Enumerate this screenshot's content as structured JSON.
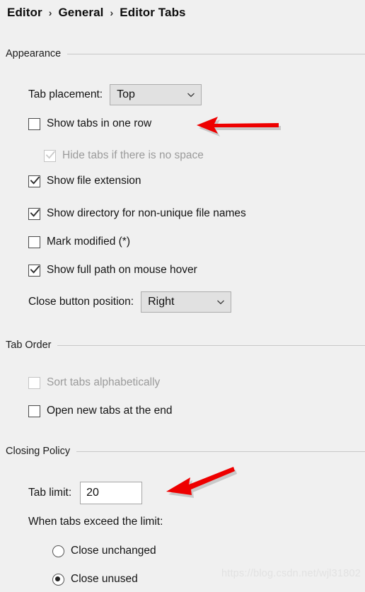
{
  "breadcrumb": {
    "separator": "›",
    "items": [
      "Editor",
      "General",
      "Editor Tabs"
    ]
  },
  "sections": {
    "appearance": {
      "title": "Appearance",
      "tab_placement": {
        "label": "Tab placement:",
        "value": "Top",
        "icon": "chevron-down-icon"
      },
      "checkboxes": [
        {
          "label": "Show tabs in one row",
          "checked": false,
          "enabled": true
        },
        {
          "label": "Hide tabs if there is no space",
          "checked": true,
          "enabled": false
        },
        {
          "label": "Show file extension",
          "checked": true,
          "enabled": true
        },
        {
          "label": "Show directory for non-unique file names",
          "checked": true,
          "enabled": true
        },
        {
          "label": "Mark modified (*)",
          "checked": false,
          "enabled": true
        },
        {
          "label": "Show full path on mouse hover",
          "checked": true,
          "enabled": true
        }
      ],
      "close_button_position": {
        "label": "Close button position:",
        "value": "Right",
        "icon": "chevron-down-icon"
      }
    },
    "tab_order": {
      "title": "Tab Order",
      "checkboxes": [
        {
          "label": "Sort tabs alphabetically",
          "checked": false,
          "enabled": false
        },
        {
          "label": "Open new tabs at the end",
          "checked": false,
          "enabled": true
        }
      ]
    },
    "closing_policy": {
      "title": "Closing Policy",
      "tab_limit": {
        "label": "Tab limit:",
        "value": "20"
      },
      "when_exceed_label": "When tabs exceed the limit:",
      "radios": [
        {
          "label": "Close unchanged",
          "selected": false
        },
        {
          "label": "Close unused",
          "selected": true
        }
      ]
    }
  },
  "annotations": {
    "color": "#ee0000",
    "arrows": [
      {
        "name": "arrow-show-tabs-in-one-row",
        "direction": "left"
      },
      {
        "name": "arrow-tab-limit",
        "direction": "down-left"
      }
    ]
  },
  "watermark": {
    "text": "https://blog.csdn.net/wjl31802"
  }
}
